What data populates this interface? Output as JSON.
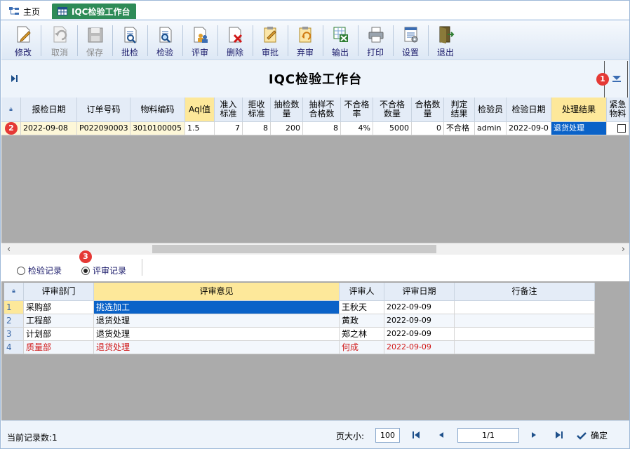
{
  "tabs": [
    {
      "label": "主页",
      "icon": "home-tree-icon"
    },
    {
      "label": "IQC检验工作台",
      "icon": "table-icon",
      "active": true
    }
  ],
  "toolbar": {
    "buttons": [
      {
        "label": "修改",
        "icon": "edit-icon",
        "enabled": true
      },
      {
        "label": "取消",
        "icon": "undo-icon",
        "enabled": false
      },
      {
        "label": "保存",
        "icon": "save-icon",
        "enabled": false
      },
      {
        "label": "批检",
        "icon": "batch-inspect-icon",
        "enabled": true
      },
      {
        "label": "检验",
        "icon": "inspect-icon",
        "enabled": true
      },
      {
        "label": "评审",
        "icon": "review-icon",
        "enabled": true
      },
      {
        "label": "删除",
        "icon": "delete-icon",
        "enabled": true
      },
      {
        "label": "审批",
        "icon": "approve-icon",
        "enabled": true
      },
      {
        "label": "弃审",
        "icon": "unapprove-icon",
        "enabled": true
      },
      {
        "label": "输出",
        "icon": "export-excel-icon",
        "enabled": true
      },
      {
        "label": "打印",
        "icon": "printer-icon",
        "enabled": true
      },
      {
        "label": "设置",
        "icon": "settings-icon",
        "enabled": true
      },
      {
        "label": "退出",
        "icon": "exit-door-icon",
        "enabled": true
      }
    ]
  },
  "page_title": "IQC检验工作台",
  "badges": {
    "b1": "1",
    "b2": "2",
    "b3": "3"
  },
  "main_grid": {
    "headers": [
      "报检日期",
      "订单号码",
      "物料编码",
      "Aql值",
      "准入标准",
      "拒收标准",
      "抽检数量",
      "抽样不合格数",
      "不合格率",
      "不合格数量",
      "合格数量",
      "判定结果",
      "检验员",
      "检验日期",
      "处理结果",
      "紧急物料"
    ],
    "row": {
      "date": "2022-09-08",
      "order": "P022090003",
      "material": "3010100005",
      "aql": "1.5",
      "accept": "7",
      "reject": "8",
      "sample": "200",
      "sample_bad": "8",
      "bad_rate": "4%",
      "bad_qty": "5000",
      "good_qty": "0",
      "verdict": "不合格",
      "inspector": "admin",
      "inspect_date": "2022-09-0",
      "result": "退货处理"
    }
  },
  "radios": {
    "inspect_record": "检验记录",
    "review_record": "评审记录",
    "selected": "review_record"
  },
  "review_grid": {
    "headers": [
      "评审部门",
      "评审意见",
      "评审人",
      "评审日期",
      "行备注"
    ],
    "rows": [
      {
        "n": "1",
        "dept": "采购部",
        "opinion": "挑选加工",
        "person": "王秋天",
        "date": "2022-09-09",
        "note": ""
      },
      {
        "n": "2",
        "dept": "工程部",
        "opinion": "退货处理",
        "person": "黄政",
        "date": "2022-09-09",
        "note": ""
      },
      {
        "n": "3",
        "dept": "计划部",
        "opinion": "退货处理",
        "person": "郑之林",
        "date": "2022-09-09",
        "note": ""
      },
      {
        "n": "4",
        "dept": "质量部",
        "opinion": "退货处理",
        "person": "何成",
        "date": "2022-09-09",
        "note": ""
      }
    ]
  },
  "status": {
    "record_count": "当前记录数:1",
    "page_size_label": "页大小:",
    "page_size": "100",
    "page": "1/1",
    "confirm": "确定"
  },
  "colors": {
    "accent": "#0a62c8",
    "tab_active": "#2e8b57",
    "header_highlight": "#fde89a",
    "badge": "#e53935",
    "alert_row": "#d01818"
  }
}
